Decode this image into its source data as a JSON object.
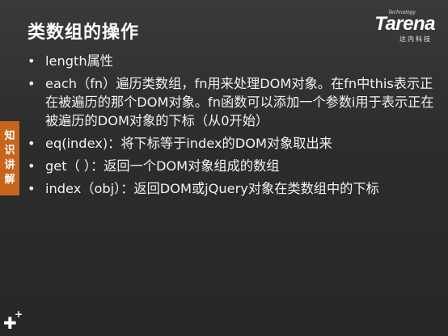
{
  "slide": {
    "title": "类数组的操作",
    "side_tab_chars": [
      "知",
      "识",
      "讲",
      "解"
    ],
    "bullets": [
      "length属性",
      "each（fn）遍历类数组，fn用来处理DOM对象。在fn中this表示正在被遍历的那个DOM对象。fn函数可以添加一个参数i用于表示正在被遍历的DOM对象的下标（从0开始）",
      "eq(index)：将下标等于index的DOM对象取出来",
      "get（ ）：返回一个DOM对象组成的数组",
      "index（obj）：返回DOM或jQuery对象在类数组中的下标"
    ]
  },
  "logo": {
    "small_text": "Technology",
    "brand_text": "Tarena",
    "chinese_text": "达内科技"
  },
  "colors": {
    "background": "#2d2d2d",
    "side_tab": "#c7651d",
    "text": "#f2f2f2"
  }
}
